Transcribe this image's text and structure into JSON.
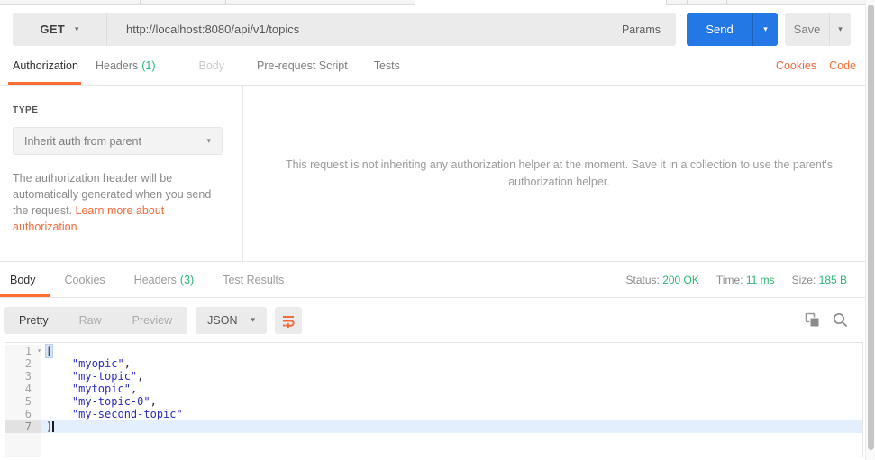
{
  "colors": {
    "accent_orange": "#ff6c37",
    "link_orange": "#f26b3b",
    "status_green": "#2cb673",
    "send_blue": "#2478e5",
    "string_blue": "#2d2dbd"
  },
  "icons": {
    "chevron_down": "▾"
  },
  "request_bar": {
    "method": "GET",
    "url": "http://localhost:8080/api/v1/topics",
    "params_label": "Params",
    "send_label": "Send",
    "save_label": "Save"
  },
  "request_tabs": {
    "authorization": "Authorization",
    "headers": "Headers",
    "headers_count": "(1)",
    "body": "Body",
    "prerequest": "Pre-request Script",
    "tests": "Tests",
    "cookies_link": "Cookies",
    "code_link": "Code"
  },
  "auth_panel": {
    "type_label": "TYPE",
    "type_value": "Inherit auth from parent",
    "description": "The authorization header will be automatically generated when you send the request. ",
    "learn_more_link": "Learn more about authorization",
    "inherit_message": "This request is not inheriting any authorization helper at the moment. Save it in a collection to use the parent's authorization helper."
  },
  "response": {
    "tabs": {
      "body": "Body",
      "cookies": "Cookies",
      "headers": "Headers",
      "headers_count": "(3)",
      "test_results": "Test Results"
    },
    "status_label": "Status:",
    "status_value": "200 OK",
    "time_label": "Time:",
    "time_value": "11 ms",
    "size_label": "Size:",
    "size_value": "185 B",
    "view_pretty": "Pretty",
    "view_raw": "Raw",
    "view_preview": "Preview",
    "format": "JSON",
    "body_json": [
      "myopic",
      "my-topic",
      "mytopic",
      "my-topic-0",
      "my-second-topic"
    ],
    "lines": {
      "l1": {
        "num": "1",
        "code": "["
      },
      "l2": {
        "num": "2",
        "indent": "    ",
        "str": "\"myopic\"",
        "sep": ","
      },
      "l3": {
        "num": "3",
        "indent": "    ",
        "str": "\"my-topic\"",
        "sep": ","
      },
      "l4": {
        "num": "4",
        "indent": "    ",
        "str": "\"mytopic\"",
        "sep": ","
      },
      "l5": {
        "num": "5",
        "indent": "    ",
        "str": "\"my-second-topic\"",
        "sep": ""
      },
      "l5b": {
        "num": "5",
        "indent": "    ",
        "str": "\"my-topic-0\"",
        "sep": ","
      },
      "l6": {
        "num": "6",
        "indent": "    ",
        "str": "\"my-second-topic\"",
        "sep": ""
      },
      "l7": {
        "num": "7",
        "code": "]"
      }
    }
  }
}
